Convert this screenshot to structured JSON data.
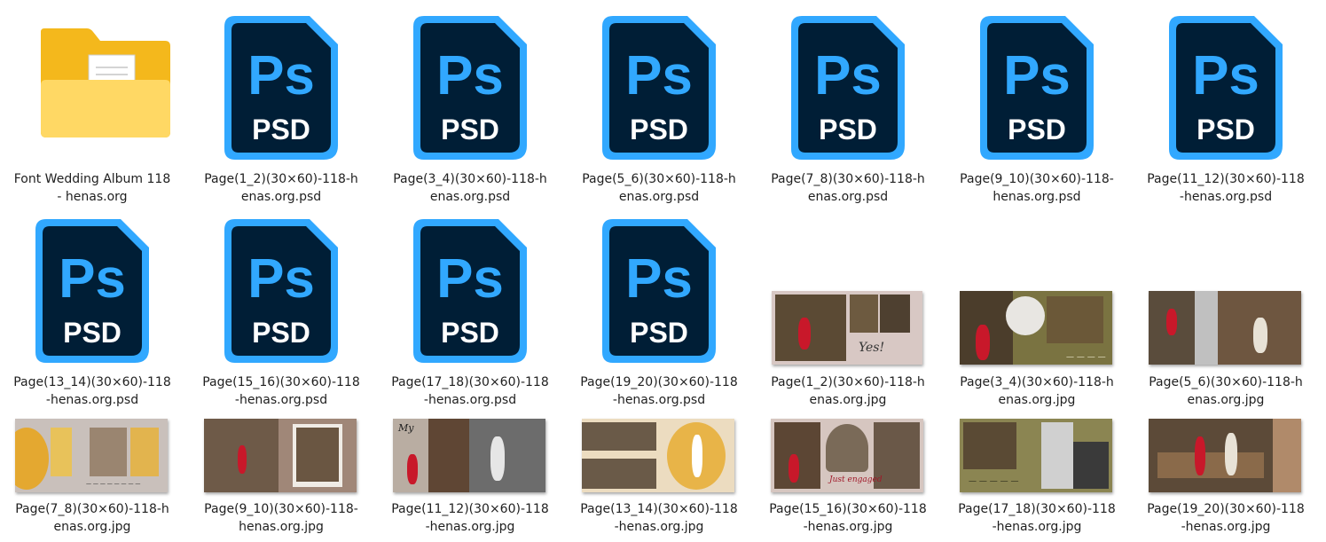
{
  "items": [
    {
      "type": "folder",
      "name": "Font Wedding Album 118 - henas.org"
    },
    {
      "type": "psd",
      "name": "Page(1_2)(30×60)-118-henas.org.psd"
    },
    {
      "type": "psd",
      "name": "Page(3_4)(30×60)-118-henas.org.psd"
    },
    {
      "type": "psd",
      "name": "Page(5_6)(30×60)-118-henas.org.psd"
    },
    {
      "type": "psd",
      "name": "Page(7_8)(30×60)-118-henas.org.psd"
    },
    {
      "type": "psd",
      "name": "Page(9_10)(30×60)-118-henas.org.psd"
    },
    {
      "type": "psd",
      "name": "Page(11_12)(30×60)-118-henas.org.psd"
    },
    {
      "type": "psd",
      "name": "Page(13_14)(30×60)-118-henas.org.psd"
    },
    {
      "type": "psd",
      "name": "Page(15_16)(30×60)-118-henas.org.psd"
    },
    {
      "type": "psd",
      "name": "Page(17_18)(30×60)-118-henas.org.psd"
    },
    {
      "type": "psd",
      "name": "Page(19_20)(30×60)-118-henas.org.psd"
    },
    {
      "type": "jpg",
      "name": "Page(1_2)(30×60)-118-henas.org.jpg"
    },
    {
      "type": "jpg",
      "name": "Page(3_4)(30×60)-118-henas.org.jpg"
    },
    {
      "type": "jpg",
      "name": "Page(5_6)(30×60)-118-henas.org.jpg"
    },
    {
      "type": "jpg",
      "name": "Page(7_8)(30×60)-118-henas.org.jpg"
    },
    {
      "type": "jpg",
      "name": "Page(9_10)(30×60)-118-henas.org.jpg"
    },
    {
      "type": "jpg",
      "name": "Page(11_12)(30×60)-118-henas.org.jpg"
    },
    {
      "type": "jpg",
      "name": "Page(13_14)(30×60)-118-henas.org.jpg"
    },
    {
      "type": "jpg",
      "name": "Page(15_16)(30×60)-118-henas.org.jpg"
    },
    {
      "type": "jpg",
      "name": "Page(17_18)(30×60)-118-henas.org.jpg"
    },
    {
      "type": "jpg",
      "name": "Page(19_20)(30×60)-118-henas.org.jpg"
    }
  ],
  "psd_icon": {
    "badge": "Ps",
    "ext": "PSD",
    "body_color": "#001e36",
    "accent_color": "#31a8ff"
  },
  "folder_icon": {
    "back_color": "#f4b81c",
    "front_color": "#ffd864"
  }
}
